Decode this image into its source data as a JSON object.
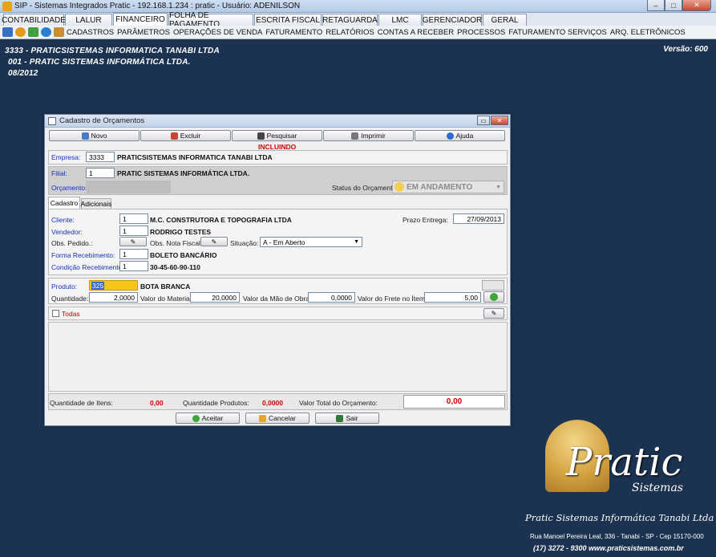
{
  "window": {
    "title": "SIP - Sistemas Integrados Pratic - 192.168.1.234 : pratic - Usuário: ADENILSON",
    "minimize": "–",
    "maximize": "□",
    "close": "✕"
  },
  "main_tabs": [
    {
      "label": "CONTABILIDADE"
    },
    {
      "label": "LALUR"
    },
    {
      "label": "FINANCEIRO"
    },
    {
      "label": "FOLHA DE PAGAMENTO"
    },
    {
      "label": "ESCRITA FISCAL"
    },
    {
      "label": "RETAGUARDA"
    },
    {
      "label": "LMC"
    },
    {
      "label": "GERENCIADOR"
    },
    {
      "label": "GERAL"
    }
  ],
  "menu": [
    {
      "label": "CADASTROS"
    },
    {
      "label": "PARÂMETROS"
    },
    {
      "label": "OPERAÇÕES DE VENDA"
    },
    {
      "label": "FATURAMENTO"
    },
    {
      "label": "RELATÓRIOS"
    },
    {
      "label": "CONTAS A RECEBER"
    },
    {
      "label": "PROCESSOS"
    },
    {
      "label": "FATURAMENTO SERVIÇOS"
    },
    {
      "label": "ARQ. ELETRÔNICOS"
    }
  ],
  "header": {
    "line1": "3333 - PRATICSISTEMAS INFORMATICA TANABI LTDA",
    "line2": "001 - PRATIC SISTEMAS INFORMÁTICA LTDA.",
    "line3": "08/2012",
    "version": "Versão: 600"
  },
  "dialog": {
    "title": "Cadastro de Orçamentos",
    "toolbar": {
      "novo": "Novo",
      "excluir": "Excluir",
      "pesquisar": "Pesquisar",
      "imprimir": "Imprimir",
      "ajuda": "Ajuda"
    },
    "mode": "INCLUINDO",
    "empresa_label": "Empresa:",
    "empresa_code": "3333",
    "empresa_name": "PRATICSISTEMAS INFORMATICA TANABI LTDA",
    "filial_label": "Filial:",
    "filial_code": "1",
    "filial_name": "PRATIC SISTEMAS INFORMÁTICA LTDA.",
    "orcamento_label": "Orçamento:",
    "status_label": "Status do Orçamento:",
    "status_value": "EM ANDAMENTO",
    "tabs": [
      {
        "label": "Cadastro"
      },
      {
        "label": "Adicionais"
      }
    ],
    "cliente_label": "Cliente:",
    "cliente_code": "1",
    "cliente_name": "M.C. CONSTRUTORA E TOPOGRAFIA LTDA",
    "prazo_label": "Prazo Entrega:",
    "prazo_value": "27/09/2013",
    "vendedor_label": "Vendedor:",
    "vendedor_code": "1",
    "vendedor_name": "RODRIGO TESTES",
    "obs_pedido_label": "Obs. Pedido.:",
    "obs_nf_label": "Obs. Nota Fiscal:",
    "situacao_label": "Situação:",
    "situacao_value": "A - Em Aberto",
    "forma_label": "Forma Recebimento:",
    "forma_code": "1",
    "forma_name": "BOLETO BANCÁRIO",
    "condicao_label": "Condição Recebimento:",
    "condicao_code": "1",
    "condicao_name": "30-45-60-90-110",
    "produto_label": "Produto:",
    "produto_code": "325",
    "produto_name": "BOTA BRANCA",
    "quantidade_label": "Quantidade:",
    "quantidade_value": "2,0000",
    "valor_material_label": "Valor do Material:",
    "valor_material_value": "20,0000",
    "valor_mao_label": "Valor da Mão de Obra:",
    "valor_mao_value": "0,0000",
    "valor_frete_label": "Valor do Frete no Ítem:",
    "valor_frete_value": "5,00",
    "todas_label": "Todas",
    "qtd_itens_label": "Quantidade de Itens:",
    "qtd_itens_value": "0,00",
    "qtd_produtos_label": "Quantidade Produtos:",
    "qtd_produtos_value": "0,0000",
    "valor_total_label": "Valor Total do Orçamento:",
    "valor_total_value": "0,00",
    "aceitar": "Aceitar",
    "cancelar": "Cancelar",
    "sair": "Sair"
  },
  "logo": {
    "word": "Pratic",
    "sub": "Sistemas",
    "company": "Pratic Sistemas Informática Tanabi Ltda",
    "address": "Rua Manoel Pereira Leal, 336 - Tanabi - SP - Cep 15170-000",
    "contact": "(17) 3272 - 9300  www.praticsistemas.com.br"
  },
  "colors": {
    "background": "#1b3350",
    "accent_red": "#cc0000",
    "label_blue": "#1531b8",
    "highlight": "#f5c518"
  }
}
